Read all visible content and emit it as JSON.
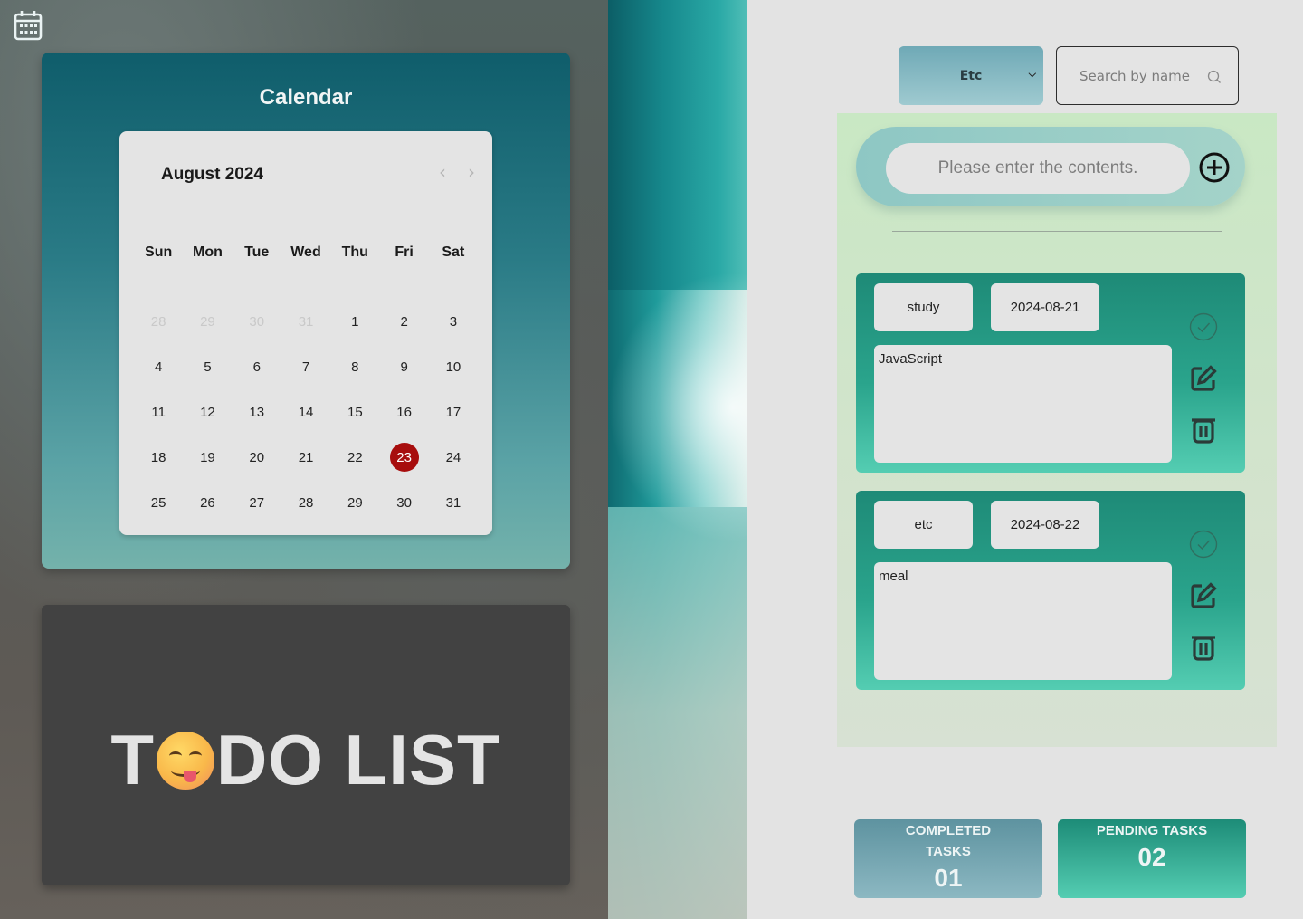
{
  "calendar": {
    "title": "Calendar",
    "month_label": "August 2024",
    "weekdays": [
      "Sun",
      "Mon",
      "Tue",
      "Wed",
      "Thu",
      "Fri",
      "Sat"
    ],
    "days": [
      {
        "n": "28",
        "muted": true
      },
      {
        "n": "29",
        "muted": true
      },
      {
        "n": "30",
        "muted": true
      },
      {
        "n": "31",
        "muted": true
      },
      {
        "n": "1"
      },
      {
        "n": "2"
      },
      {
        "n": "3"
      },
      {
        "n": "4"
      },
      {
        "n": "5"
      },
      {
        "n": "6"
      },
      {
        "n": "7"
      },
      {
        "n": "8"
      },
      {
        "n": "9"
      },
      {
        "n": "10"
      },
      {
        "n": "11"
      },
      {
        "n": "12"
      },
      {
        "n": "13"
      },
      {
        "n": "14"
      },
      {
        "n": "15"
      },
      {
        "n": "16"
      },
      {
        "n": "17"
      },
      {
        "n": "18"
      },
      {
        "n": "19"
      },
      {
        "n": "20"
      },
      {
        "n": "21"
      },
      {
        "n": "22"
      },
      {
        "n": "23",
        "today": true
      },
      {
        "n": "24"
      },
      {
        "n": "25"
      },
      {
        "n": "26"
      },
      {
        "n": "27"
      },
      {
        "n": "28"
      },
      {
        "n": "29"
      },
      {
        "n": "30"
      },
      {
        "n": "31"
      }
    ],
    "today_color": "#a70d0d"
  },
  "banner": {
    "title_before": "T",
    "title_after": "DO LIST"
  },
  "filter": {
    "selected": "Etc"
  },
  "search": {
    "placeholder": "Search by name"
  },
  "add_todo": {
    "placeholder": "Please enter the contents."
  },
  "tasks": [
    {
      "tag": "study",
      "date": "2024-08-21",
      "content": "JavaScript"
    },
    {
      "tag": "etc",
      "date": "2024-08-22",
      "content": "meal"
    }
  ],
  "stats": {
    "completed_label": "COMPLETED TASKS",
    "completed_count": "01",
    "pending_label": "PENDING TASKS",
    "pending_count": "02"
  },
  "colors": {
    "accent_teal": "#1e8a77",
    "panel_green": "#c9e8c4",
    "today": "#a70d0d"
  }
}
